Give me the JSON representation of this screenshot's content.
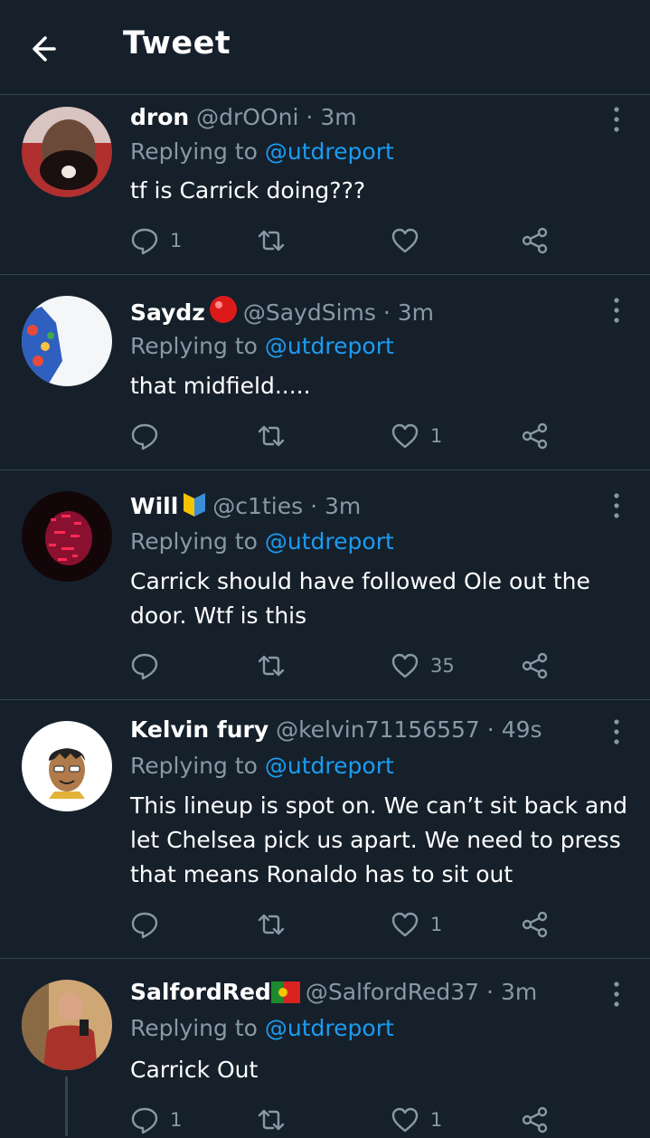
{
  "header": {
    "title": "Tweet"
  },
  "tweets": [
    {
      "name": "dron",
      "handle": "@drOOni",
      "sep": "·",
      "time": "3m",
      "emoji": "",
      "replying_prefix": "Replying to",
      "replying_to": "@utdreport",
      "text": "tf is Carrick doing???",
      "replies": "1",
      "retweets": "",
      "likes": ""
    },
    {
      "name": "Saydz",
      "handle": "@SaydSims",
      "sep": "·",
      "time": "3m",
      "emoji": "red-circle",
      "replying_prefix": "Replying to",
      "replying_to": "@utdreport",
      "text": "that midfield.....",
      "replies": "",
      "retweets": "",
      "likes": "1"
    },
    {
      "name": "Will",
      "handle": "@c1ties",
      "sep": "·",
      "time": "3m",
      "emoji": "beginner-badge",
      "replying_prefix": "Replying to",
      "replying_to": "@utdreport",
      "text": "Carrick should have followed Ole out the door. Wtf is this",
      "replies": "",
      "retweets": "",
      "likes": "35"
    },
    {
      "name": "Kelvin fury",
      "handle": "@kelvin71156557",
      "sep": "·",
      "time": "49s",
      "emoji": "",
      "replying_prefix": "Replying to",
      "replying_to": "@utdreport",
      "text": "This lineup is spot on. We can’t sit back and let Chelsea pick us apart. We need to press that means Ronaldo has to sit out",
      "replies": "",
      "retweets": "",
      "likes": "1"
    },
    {
      "name": "SalfordRed",
      "handle": "@SalfordRed37",
      "sep": "·",
      "time": "3m",
      "emoji": "portugal-flag",
      "replying_prefix": "Replying to",
      "replying_to": "@utdreport",
      "text": "Carrick Out",
      "replies": "1",
      "retweets": "",
      "likes": "1"
    }
  ],
  "colors": {
    "background": "#15202b",
    "secondary_text": "#8899a6",
    "link": "#1d9bf0",
    "divider": "#38444d"
  }
}
